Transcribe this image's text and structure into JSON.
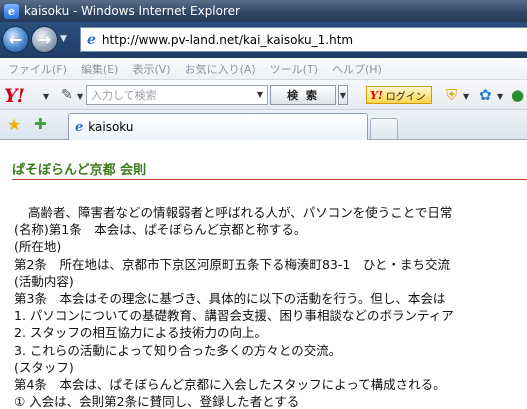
{
  "window": {
    "title": "kaisoku - Windows Internet Explorer"
  },
  "address": {
    "url": "http://www.pv-land.net/kai_kaisoku_1.htm"
  },
  "menu": [
    "ファイル(F)",
    "編集(E)",
    "表示(V)",
    "お気に入り(A)",
    "ツール(T)",
    "ヘルプ(H)"
  ],
  "yahoo_toolbar": {
    "logo": "Y!",
    "search_placeholder": "入力して検索",
    "search_button": "検 索",
    "login_label": "ログイン",
    "login_logo": "Y!"
  },
  "tab": {
    "label": "kaisoku"
  },
  "page": {
    "title": "ぱそぼらんど京都 会則",
    "lines": [
      "高齢者、障害者などの情報弱者と呼ばれる人が、パソコンを使うことで日常",
      "(名称)第1条　本会は、ぱそぼらんど京都と称する。",
      "(所在地)",
      "第2条　所在地は、京都市下京区河原町五条下る梅湊町83-1　ひと・まち交流",
      "(活動内容)",
      "第3条　本会はその理念に基づき、具体的に以下の活動を行う。但し、本会は",
      "1. パソコンについての基礎教育、講習会支援、困り事相談などのボランティア",
      "2. スタッフの相互協力による技術力の向上。",
      "3. これらの活動によって知り合った多くの方々との交流。",
      "(スタッフ)",
      "第4条　本会は、ぱそぼらんど京都に入会したスタッフによって構成される。",
      "①  入会は、会則第2条に賛同し、登録した者とする"
    ]
  },
  "icons": {
    "back": "back-arrow-icon",
    "forward": "forward-arrow-icon",
    "favorites": "favorites-star-icon",
    "add_favorites": "add-favorites-icon",
    "ie": "ie-page-icon",
    "shield": "security-shield-icon"
  },
  "colors": {
    "title_green": "#3d7a1f",
    "rule_red": "#c8392b",
    "yahoo_red": "#d0021b"
  }
}
